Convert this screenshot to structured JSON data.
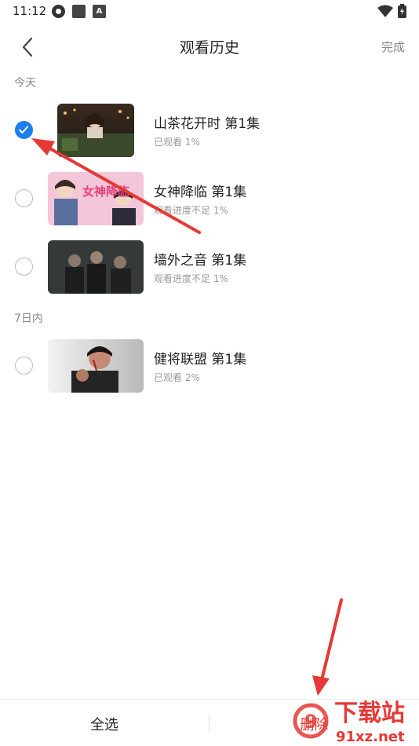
{
  "status_bar": {
    "time": "11:12"
  },
  "header": {
    "title": "观看历史",
    "done_label": "完成"
  },
  "sections": [
    {
      "label": "今天",
      "items": [
        {
          "title": "山茶花开时 第1集",
          "progress": "已观看 1%",
          "checked": true
        },
        {
          "title": "女神降临 第1集",
          "progress": "观看进度不足 1%",
          "checked": false,
          "thumb_text": "女神降临"
        },
        {
          "title": "墙外之音 第1集",
          "progress": "观看进度不足 1%",
          "checked": false
        }
      ]
    },
    {
      "label": "7日内",
      "items": [
        {
          "title": "健将联盟 第1集",
          "progress": "已观看 2%",
          "checked": false
        }
      ]
    }
  ],
  "bottom_bar": {
    "select_all_label": "全选",
    "delete_label": "删除"
  },
  "watermark": {
    "text": "下载站",
    "url": "91xz.net",
    "logo_text": "9"
  },
  "colors": {
    "accent": "#1b7ff0",
    "delete": "#e53935",
    "arrow": "#e53935",
    "watermark": "#e53935"
  }
}
